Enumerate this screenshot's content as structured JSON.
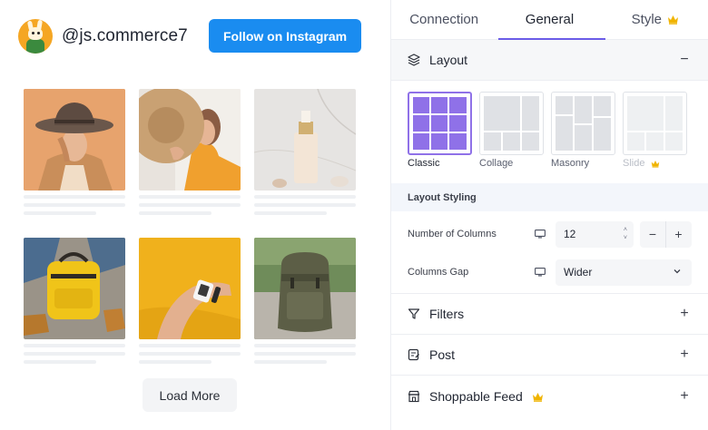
{
  "preview": {
    "handle": "@js.commerce7",
    "follow_label": "Follow on Instagram",
    "load_more_label": "Load More",
    "posts": [
      {
        "subject": "woman in brown hat"
      },
      {
        "subject": "woman holding straw hat"
      },
      {
        "subject": "cosmetic bottle on marble"
      },
      {
        "subject": "yellow backpack"
      },
      {
        "subject": "wrist watch on yellow"
      },
      {
        "subject": "olive canvas backpack"
      }
    ]
  },
  "panel": {
    "tabs": [
      {
        "label": "Connection",
        "active": false
      },
      {
        "label": "General",
        "active": true
      },
      {
        "label": "Style",
        "active": false,
        "pro": true
      }
    ],
    "sections": {
      "layout": {
        "label": "Layout",
        "toggle": "−",
        "icon": "layers-icon"
      },
      "filters": {
        "label": "Filters",
        "toggle": "+",
        "icon": "filter-icon"
      },
      "post": {
        "label": "Post",
        "toggle": "+",
        "icon": "post-icon"
      },
      "shoppable": {
        "label": "Shoppable Feed",
        "toggle": "+",
        "icon": "storefront-icon",
        "pro": true
      }
    },
    "layouts": [
      {
        "label": "Classic",
        "selected": true
      },
      {
        "label": "Collage",
        "selected": false
      },
      {
        "label": "Masonry",
        "selected": false
      },
      {
        "label": "Slide",
        "selected": false,
        "pro": true
      }
    ],
    "layout_styling": {
      "heading": "Layout Styling",
      "columns_label": "Number of Columns",
      "columns_value": "12",
      "gap_label": "Columns Gap",
      "gap_value": "Wider"
    }
  },
  "colors": {
    "accent": "#6b5ce7",
    "follow": "#1a8cf0",
    "pro_crown": "#f0b400"
  }
}
